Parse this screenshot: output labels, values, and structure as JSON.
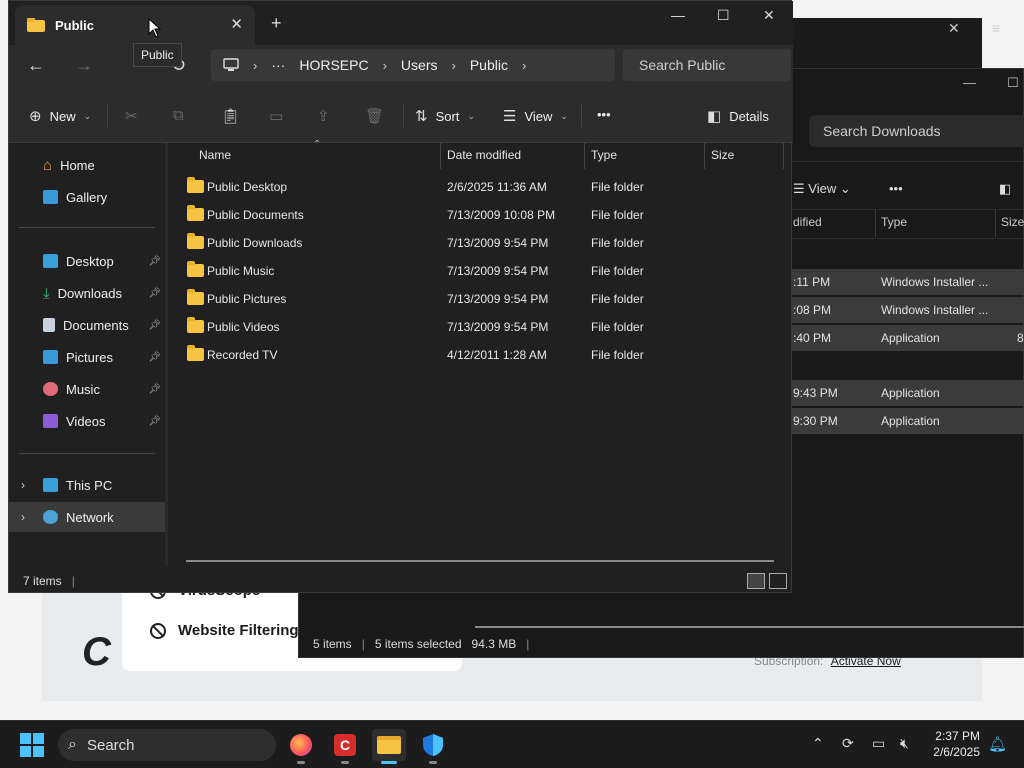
{
  "background_app": {
    "rows": [
      "VirusScope",
      "Website Filtering"
    ],
    "logo": "C",
    "subscription_label": "Subscription:",
    "activate_link": "Activate Now"
  },
  "downloads_window": {
    "search_placeholder": "Search Downloads",
    "toolbar": {
      "view_label": "View",
      "more_label": "•••"
    },
    "columns": [
      "dified",
      "Type",
      "Size"
    ],
    "rows": [
      {
        "date": ":11 PM",
        "type": "Windows Installer ...",
        "size": ""
      },
      {
        "date": ":08 PM",
        "type": "Windows Installer ...",
        "size": ""
      },
      {
        "date": ":40 PM",
        "type": "Application",
        "size": "8"
      },
      {
        "date": "9:43 PM",
        "type": "Application",
        "size": ""
      },
      {
        "date": "9:30 PM",
        "type": "Application",
        "size": ""
      }
    ],
    "status": {
      "items": "5 items",
      "selected": "5 items selected",
      "size": "94.3 MB"
    }
  },
  "explorer": {
    "tab_title": "Public",
    "tooltip": "Public",
    "address": {
      "more": "···",
      "crumbs": [
        "HORSEPC",
        "Users",
        "Public"
      ]
    },
    "search_placeholder": "Search Public",
    "commands": {
      "new": "New",
      "sort": "Sort",
      "view": "View",
      "more": "•••",
      "details": "Details"
    },
    "nav": {
      "home": "Home",
      "gallery": "Gallery",
      "quick": [
        "Desktop",
        "Downloads",
        "Documents",
        "Pictures",
        "Music",
        "Videos"
      ],
      "this_pc": "This PC",
      "network": "Network"
    },
    "columns": {
      "name": "Name",
      "date": "Date modified",
      "type": "Type",
      "size": "Size"
    },
    "files": [
      {
        "name": "Public Desktop",
        "date": "2/6/2025 11:36 AM",
        "type": "File folder",
        "size": ""
      },
      {
        "name": "Public Documents",
        "date": "7/13/2009 10:08 PM",
        "type": "File folder",
        "size": ""
      },
      {
        "name": "Public Downloads",
        "date": "7/13/2009 9:54 PM",
        "type": "File folder",
        "size": ""
      },
      {
        "name": "Public Music",
        "date": "7/13/2009 9:54 PM",
        "type": "File folder",
        "size": ""
      },
      {
        "name": "Public Pictures",
        "date": "7/13/2009 9:54 PM",
        "type": "File folder",
        "size": ""
      },
      {
        "name": "Public Videos",
        "date": "7/13/2009 9:54 PM",
        "type": "File folder",
        "size": ""
      },
      {
        "name": "Recorded TV",
        "date": "4/12/2011 1:28 AM",
        "type": "File folder",
        "size": ""
      }
    ],
    "status": {
      "count": "7 items"
    }
  },
  "taskbar": {
    "search_label": "Search",
    "time": "2:37 PM",
    "date": "2/6/2025"
  }
}
